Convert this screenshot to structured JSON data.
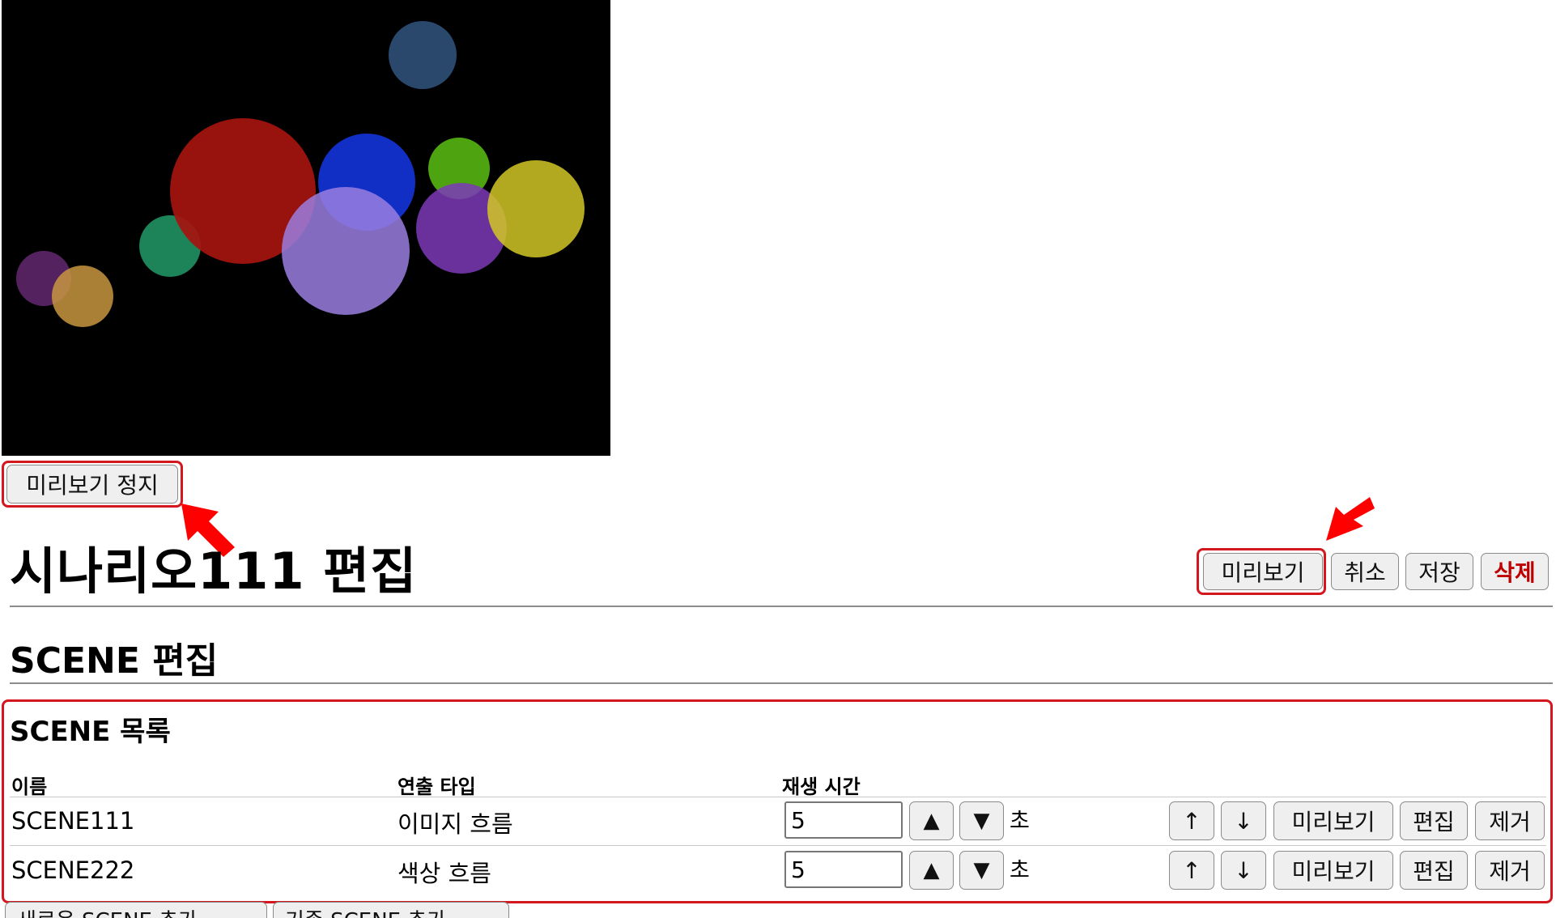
{
  "preview": {
    "stop_label": "미리보기 정지"
  },
  "header": {
    "title": "시나리오111 편집",
    "preview_label": "미리보기",
    "cancel_label": "취소",
    "save_label": "저장",
    "delete_label": "삭제"
  },
  "scene_edit": {
    "title": "SCENE 편집"
  },
  "scene_list": {
    "title": "SCENE 목록",
    "columns": [
      "이름",
      "연출 타입",
      "재생 시간"
    ],
    "rows": [
      {
        "name": "SCENE111",
        "type": "이미지 흐름",
        "duration": "5",
        "unit": "초"
      },
      {
        "name": "SCENE222",
        "type": "색상 흐름",
        "duration": "5",
        "unit": "초"
      }
    ],
    "row_actions": {
      "inc": "▲",
      "dec": "▼",
      "move_up": "↑",
      "move_down": "↓",
      "preview": "미리보기",
      "edit": "편집",
      "remove": "제거"
    }
  },
  "bottom_buttons": [
    "새로운 SCENE 추가",
    "기존 SCENE 추가"
  ],
  "colors": {
    "highlight": "#d4171f",
    "danger_text": "#c00000",
    "canvas_bg": "#000000"
  }
}
